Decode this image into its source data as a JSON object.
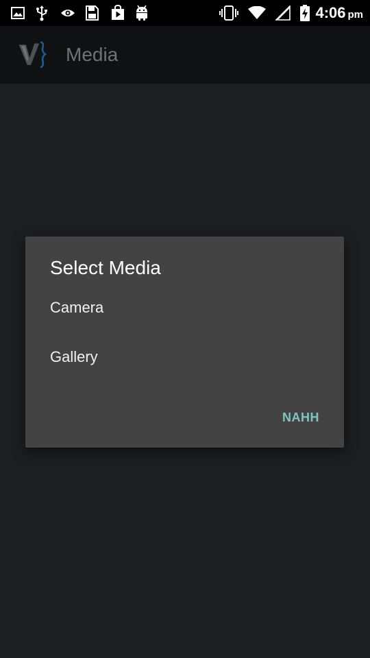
{
  "status_bar": {
    "time": "4:06",
    "ampm": "pm",
    "left_icons": [
      "image-icon",
      "usb-icon",
      "eye-icon",
      "sd-card-icon",
      "play-store-icon",
      "android-icon"
    ],
    "right_icons": [
      "vibrate-icon",
      "wifi-icon",
      "cell-signal-icon",
      "battery-charging-icon"
    ]
  },
  "app_bar": {
    "title": "Media",
    "logo_icon": "app-logo-icon"
  },
  "dialog": {
    "title": "Select Media",
    "options": [
      {
        "label": "Camera"
      },
      {
        "label": "Gallery"
      }
    ],
    "action_label": "NAHH"
  },
  "colors": {
    "status_bar_bg": "#000000",
    "app_bar_bg": "#0f1112",
    "content_bg": "#1b1f22",
    "dialog_bg": "#434343",
    "accent": "#7ec6c6"
  }
}
